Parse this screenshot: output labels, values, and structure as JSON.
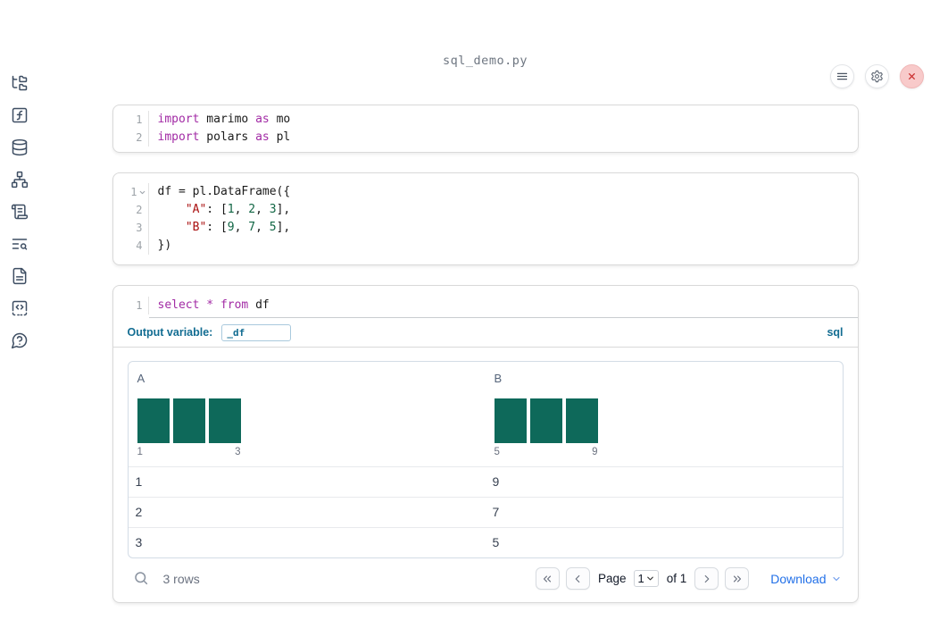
{
  "app": {
    "title": "sql_demo.py"
  },
  "toolbar": {
    "icons": [
      "hamburger-menu",
      "settings-gear",
      "shutdown-close"
    ]
  },
  "sidebar": {
    "icons": [
      "file-explorer",
      "variables",
      "datasets",
      "dependency-graph",
      "logs",
      "search-logs",
      "documentation",
      "snippets",
      "help"
    ]
  },
  "cells": [
    {
      "lines": [
        {
          "num": "1",
          "tokens": [
            {
              "t": "import",
              "c": "kw"
            },
            {
              "t": " marimo ",
              "c": "pl"
            },
            {
              "t": "as",
              "c": "kw"
            },
            {
              "t": " mo",
              "c": "pl"
            }
          ]
        },
        {
          "num": "2",
          "tokens": [
            {
              "t": "import",
              "c": "kw"
            },
            {
              "t": " polars ",
              "c": "pl"
            },
            {
              "t": "as",
              "c": "kw"
            },
            {
              "t": " pl",
              "c": "pl"
            }
          ]
        }
      ]
    },
    {
      "lines": [
        {
          "num": "1",
          "tokens": [
            {
              "t": "df = pl.DataFrame({",
              "c": "pl"
            }
          ]
        },
        {
          "num": "2",
          "tokens": [
            {
              "t": "    ",
              "c": "pl"
            },
            {
              "t": "\"A\"",
              "c": "str"
            },
            {
              "t": ": [",
              "c": "pl"
            },
            {
              "t": "1",
              "c": "num"
            },
            {
              "t": ", ",
              "c": "pl"
            },
            {
              "t": "2",
              "c": "num"
            },
            {
              "t": ", ",
              "c": "pl"
            },
            {
              "t": "3",
              "c": "num"
            },
            {
              "t": "],",
              "c": "pl"
            }
          ]
        },
        {
          "num": "3",
          "tokens": [
            {
              "t": "    ",
              "c": "pl"
            },
            {
              "t": "\"B\"",
              "c": "str"
            },
            {
              "t": ": [",
              "c": "pl"
            },
            {
              "t": "9",
              "c": "num"
            },
            {
              "t": ", ",
              "c": "pl"
            },
            {
              "t": "7",
              "c": "num"
            },
            {
              "t": ", ",
              "c": "pl"
            },
            {
              "t": "5",
              "c": "num"
            },
            {
              "t": "],",
              "c": "pl"
            }
          ]
        },
        {
          "num": "4",
          "tokens": [
            {
              "t": "})",
              "c": "pl"
            }
          ]
        }
      ]
    },
    {
      "lines": [
        {
          "num": "1",
          "tokens": [
            {
              "t": "select",
              "c": "kw"
            },
            {
              "t": " ",
              "c": "pl"
            },
            {
              "t": "*",
              "c": "kw"
            },
            {
              "t": " ",
              "c": "pl"
            },
            {
              "t": "from",
              "c": "kw"
            },
            {
              "t": " df",
              "c": "pl"
            }
          ]
        }
      ]
    }
  ],
  "sql_cell": {
    "output_variable_label": "Output variable:",
    "output_variable_value": "_df",
    "language": "sql"
  },
  "table": {
    "columns": [
      {
        "name": "A",
        "histogram": {
          "bars": [
            1,
            1,
            1
          ],
          "min_label": "1",
          "max_label": "3"
        }
      },
      {
        "name": "B",
        "histogram": {
          "bars": [
            1,
            1,
            1
          ],
          "min_label": "5",
          "max_label": "9"
        }
      }
    ],
    "rows": [
      [
        "1",
        "9"
      ],
      [
        "2",
        "7"
      ],
      [
        "3",
        "5"
      ]
    ],
    "footer": {
      "row_count": "3 rows",
      "page_label": "Page",
      "page_value": "1",
      "of_label": "of 1",
      "download_label": "Download"
    }
  },
  "colors": {
    "histogram_bar": "#0e695a",
    "link_blue": "#2270e8",
    "sql_accent": "#136d92"
  }
}
